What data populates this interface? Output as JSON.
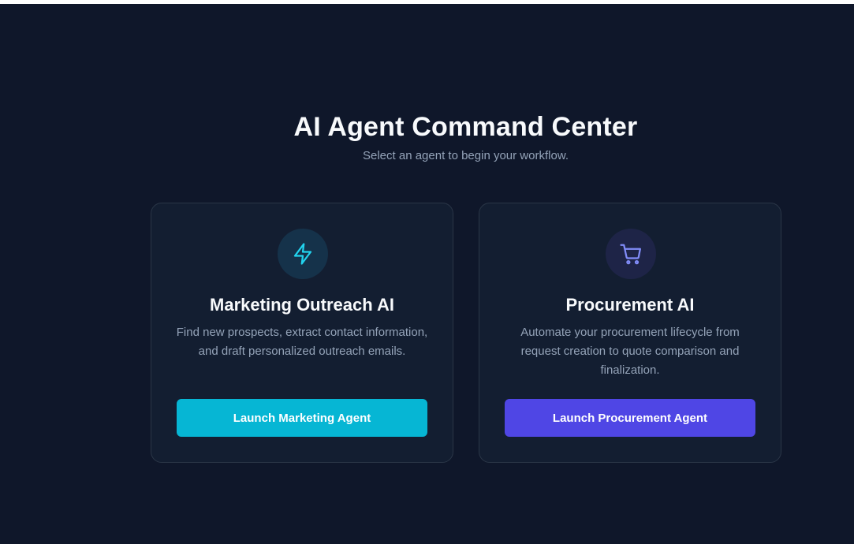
{
  "header": {
    "title": "AI Agent Command Center",
    "subtitle": "Select an agent to begin your workflow."
  },
  "agents": [
    {
      "icon": "lightning-bolt-icon",
      "icon_color": "#22d3ee",
      "title": "Marketing Outreach AI",
      "description": "Find new prospects, extract contact information, and draft personalized outreach emails.",
      "button_label": "Launch Marketing Agent",
      "button_color": "#06b6d4"
    },
    {
      "icon": "shopping-cart-icon",
      "icon_color": "#818cf8",
      "title": "Procurement AI",
      "description": "Automate your procurement lifecycle from request creation to quote comparison and finalization.",
      "button_label": "Launch Procurement Agent",
      "button_color": "#4f46e5"
    }
  ],
  "colors": {
    "background": "#0f172a",
    "card_background": "#131e31",
    "card_border": "#2a3647",
    "title_text": "#f8fafc",
    "muted_text": "#94a3b8"
  }
}
